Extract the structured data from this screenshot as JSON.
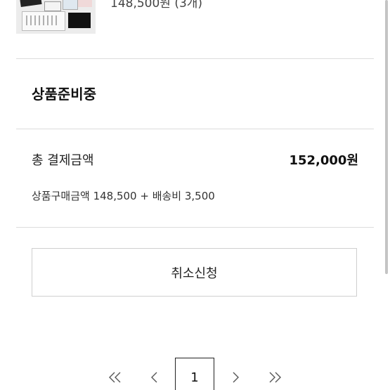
{
  "product": {
    "price_line": "148,500원 (3개)"
  },
  "order": {
    "status": "상품준비중",
    "total_label": "총 결제금액",
    "total_value": "152,000원",
    "breakdown": "상품구매금액 148,500 + 배송비 3,500"
  },
  "actions": {
    "cancel_label": "취소신청"
  },
  "pagination": {
    "current_page": "1"
  },
  "icons": {
    "first": "double-chevron-left-icon",
    "prev": "chevron-left-icon",
    "next": "chevron-right-icon",
    "last": "double-chevron-right-icon"
  }
}
